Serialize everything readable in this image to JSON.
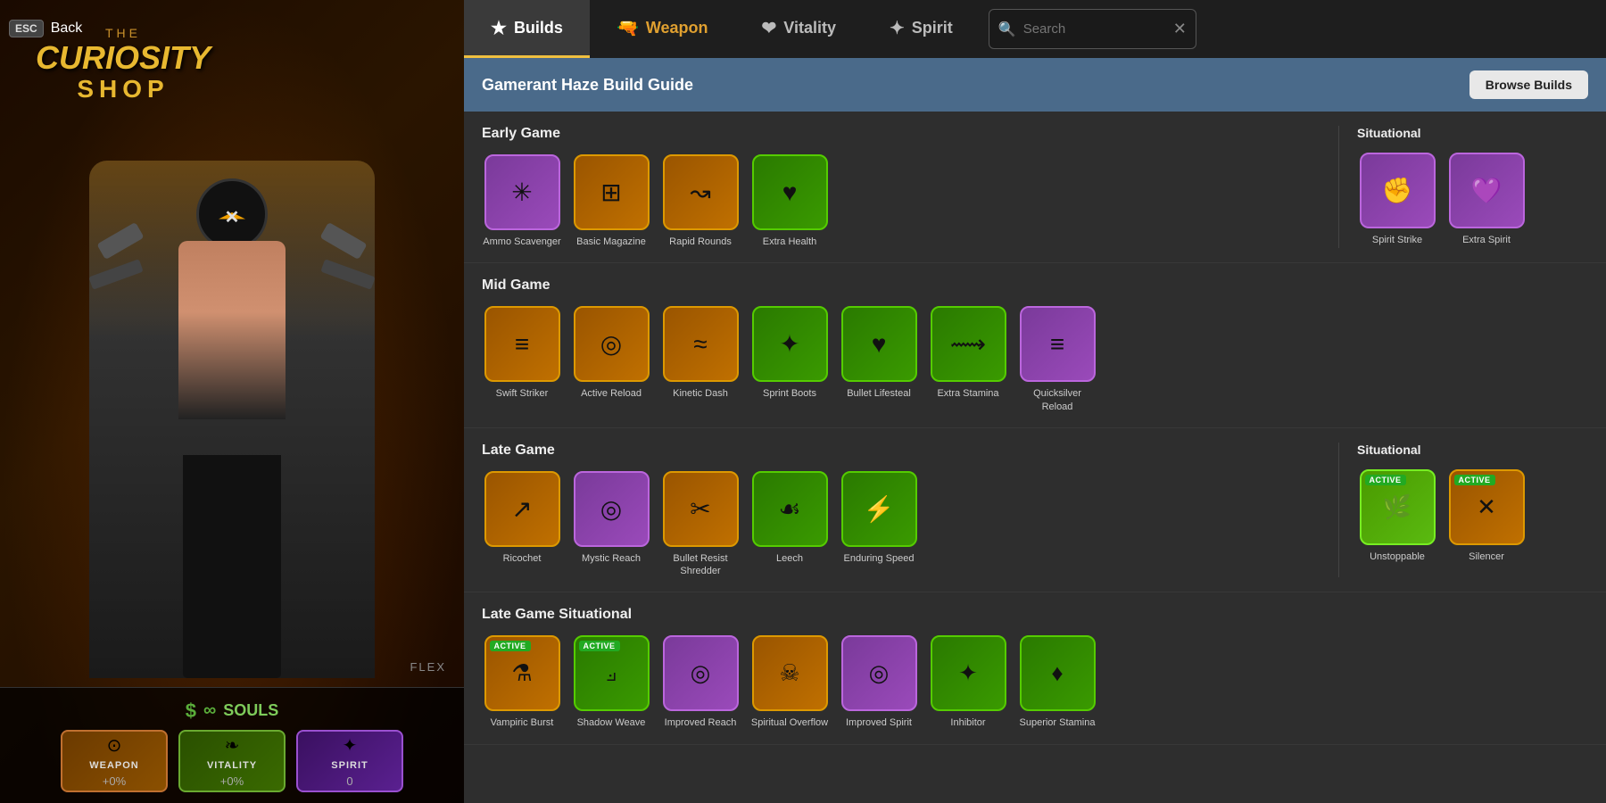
{
  "left": {
    "esc": "ESC",
    "back": "Back",
    "shop_the": "THE",
    "shop_curiosity": "CURIOSITY",
    "shop_word": "SHOP",
    "souls_label": "SOULS",
    "stats": [
      {
        "key": "weapon",
        "label": "WEAPON",
        "value": "+0%",
        "icon": "⊙"
      },
      {
        "key": "vitality",
        "label": "VITALITY",
        "value": "+0%",
        "icon": "❧"
      },
      {
        "key": "spirit",
        "label": "SPIRIT",
        "value": "0",
        "icon": "✦"
      }
    ],
    "flex_label": "FLEX"
  },
  "tabs": [
    {
      "key": "builds",
      "label": "Builds",
      "icon": "★",
      "active": true
    },
    {
      "key": "weapon",
      "label": "Weapon",
      "icon": "🔫",
      "active": false
    },
    {
      "key": "vitality",
      "label": "Vitality",
      "icon": "❤",
      "active": false
    },
    {
      "key": "spirit",
      "label": "Spirit",
      "icon": "✦",
      "active": false
    }
  ],
  "search": {
    "placeholder": "Search",
    "value": ""
  },
  "build_guide": {
    "title": "Gamerant Haze Build Guide",
    "browse_builds": "Browse Builds"
  },
  "early_game": {
    "label": "Early Game",
    "items": [
      {
        "name": "Ammo Scavenger",
        "color": "purple",
        "icon": "✳",
        "active": false
      },
      {
        "name": "Basic Magazine",
        "color": "orange",
        "icon": "⊞",
        "active": false
      },
      {
        "name": "Rapid Rounds",
        "color": "orange",
        "icon": "↝",
        "active": false
      },
      {
        "name": "Extra Health",
        "color": "green",
        "icon": "♥",
        "active": false
      }
    ]
  },
  "early_situational": {
    "label": "Situational",
    "items": [
      {
        "name": "Spirit Strike",
        "color": "purple",
        "icon": "✊",
        "active": false
      },
      {
        "name": "Extra Spirit",
        "color": "purple",
        "icon": "💜",
        "active": false
      }
    ]
  },
  "mid_game": {
    "label": "Mid Game",
    "items": [
      {
        "name": "Swift Striker",
        "color": "orange",
        "icon": "≡",
        "active": false
      },
      {
        "name": "Active Reload",
        "color": "orange",
        "icon": "◎",
        "active": false
      },
      {
        "name": "Kinetic Dash",
        "color": "orange",
        "icon": "≈",
        "active": false
      },
      {
        "name": "Sprint Boots",
        "color": "green",
        "icon": "✦",
        "active": false
      },
      {
        "name": "Bullet Lifesteal",
        "color": "green",
        "icon": "♥",
        "active": false
      },
      {
        "name": "Extra Stamina",
        "color": "green",
        "icon": "⟿",
        "active": false
      },
      {
        "name": "Quicksilver Reload",
        "color": "purple",
        "icon": "≡",
        "active": false
      }
    ]
  },
  "late_game": {
    "label": "Late Game",
    "items": [
      {
        "name": "Ricochet",
        "color": "orange",
        "icon": "↗",
        "active": false
      },
      {
        "name": "Mystic Reach",
        "color": "purple",
        "icon": "◎",
        "active": false
      },
      {
        "name": "Bullet Resist Shredder",
        "color": "orange",
        "icon": "✂",
        "active": false
      },
      {
        "name": "Leech",
        "color": "green",
        "icon": "☙",
        "active": false
      },
      {
        "name": "Enduring Speed",
        "color": "green",
        "icon": "⚡",
        "active": false
      }
    ]
  },
  "late_situational": {
    "label": "Situational",
    "items": [
      {
        "name": "Unstoppable",
        "color": "green",
        "icon": "🌿",
        "active": true
      },
      {
        "name": "Silencer",
        "color": "orange",
        "icon": "✕",
        "active": true
      }
    ]
  },
  "late_game_situational": {
    "label": "Late Game Situational",
    "items": [
      {
        "name": "Vampiric Burst",
        "color": "orange",
        "icon": "⚗",
        "active": true
      },
      {
        "name": "Shadow Weave",
        "color": "green",
        "icon": "⟓",
        "active": true
      },
      {
        "name": "Improved Reach",
        "color": "purple",
        "icon": "◎",
        "active": false
      },
      {
        "name": "Spiritual Overflow",
        "color": "orange",
        "icon": "☠",
        "active": false
      },
      {
        "name": "Improved Spirit",
        "color": "purple",
        "icon": "◎",
        "active": false
      },
      {
        "name": "Inhibitor",
        "color": "green",
        "icon": "✦",
        "active": false
      },
      {
        "name": "Superior Stamina",
        "color": "green",
        "icon": "♦",
        "active": false
      }
    ]
  }
}
